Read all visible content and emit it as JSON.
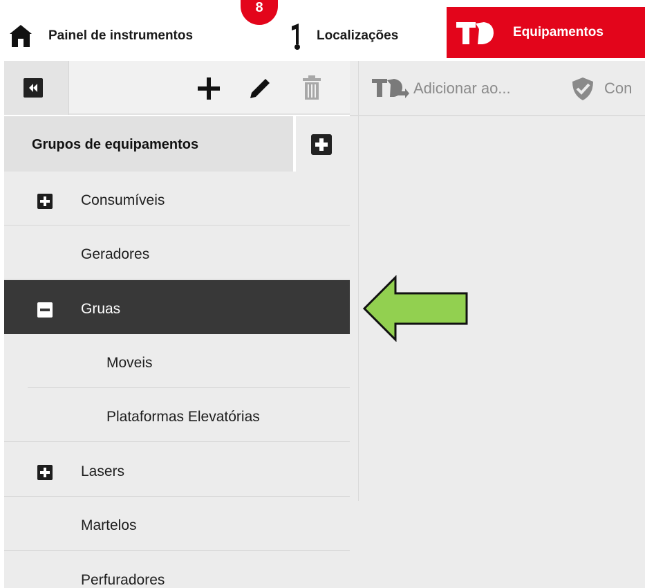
{
  "topnav": {
    "dashboard_label": "Painel de instrumentos",
    "locations_label": "Localizações",
    "equipment_label": "Equipamentos",
    "notification_count": "8",
    "active_color": "#e3051b"
  },
  "left_toolbar": {
    "icons": [
      "collapse-icon",
      "add-icon",
      "edit-icon",
      "trash-icon"
    ]
  },
  "right_toolbar": {
    "add_to_label": "Adicionar ao...",
    "second_label": "Con"
  },
  "groups": {
    "header": "Grupos de equipamentos",
    "items": [
      {
        "label": "Consumíveis",
        "toggle": "expand",
        "selected": false
      },
      {
        "label": "Geradores",
        "toggle": "none",
        "selected": false
      },
      {
        "label": "Gruas",
        "toggle": "collapse",
        "selected": true
      },
      {
        "label": "Moveis",
        "toggle": "none",
        "selected": false,
        "child": true
      },
      {
        "label": "Plataformas Elevatórias",
        "toggle": "none",
        "selected": false,
        "child": true
      },
      {
        "label": "Lasers",
        "toggle": "expand",
        "selected": false
      },
      {
        "label": "Martelos",
        "toggle": "none",
        "selected": false
      },
      {
        "label": "Perfuradores",
        "toggle": "none",
        "selected": false
      }
    ]
  },
  "annotation": {
    "arrow_color": "#92d050"
  }
}
